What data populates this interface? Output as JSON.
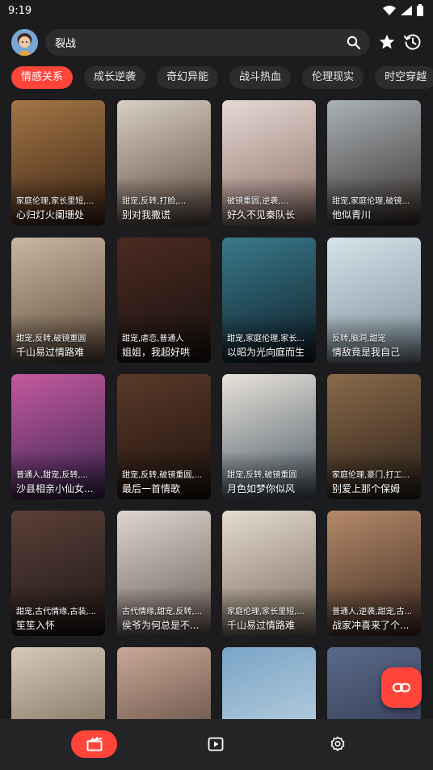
{
  "status": {
    "time": "9:19"
  },
  "search": {
    "value": "裂战"
  },
  "categories": [
    "情感关系",
    "成长逆袭",
    "奇幻异能",
    "战斗热血",
    "伦理现实",
    "时空穿越"
  ],
  "active_category": "情感关系",
  "dramas": [
    {
      "tags": "家庭伦理,家长里短,...",
      "title": "心归灯火阑珊处",
      "colors": [
        "#a37646",
        "#3c2414"
      ]
    },
    {
      "tags": "甜宠,反转,打脸,...",
      "title": "别对我撒谎",
      "colors": [
        "#d9cfc4",
        "#5b4a3f"
      ]
    },
    {
      "tags": "破镜重圆,逆袭,...",
      "title": "好久不见秦队长",
      "colors": [
        "#e6d9d3",
        "#8a6e66"
      ]
    },
    {
      "tags": "甜宠,家庭伦理,破镜...",
      "title": "他似青川",
      "colors": [
        "#aab2b8",
        "#38302b"
      ]
    },
    {
      "tags": "甜宠,反转,破镜重圆",
      "title": "千山易过情路难",
      "colors": [
        "#c9b7a1",
        "#5e4b3b"
      ]
    },
    {
      "tags": "甜宠,虐恋,普通人",
      "title": "姐姐，我超好哄",
      "colors": [
        "#4b2b22",
        "#17100d"
      ]
    },
    {
      "tags": "甜宠,家庭伦理,家长...",
      "title": "以昭为光向庭而生",
      "colors": [
        "#3a7a8c",
        "#0e1e27"
      ]
    },
    {
      "tags": "反转,脑洞,甜宠",
      "title": "情敌竟是我自己",
      "colors": [
        "#d5e3ea",
        "#7d8f99"
      ]
    },
    {
      "tags": "普通人,甜宠,反转,...",
      "title": "沙县相亲小仙女...",
      "colors": [
        "#c45aa0",
        "#3a2450"
      ]
    },
    {
      "tags": "甜宠,反转,破镜重圆,...",
      "title": "最后一首情歌",
      "colors": [
        "#5a3a2a",
        "#1d120c"
      ]
    },
    {
      "tags": "甜宠,反转,破镜重圆",
      "title": "月色如梦你似风",
      "colors": [
        "#e8e2da",
        "#4a5a66"
      ]
    },
    {
      "tags": "家庭伦理,豪门,打工...",
      "title": "别爱上那个保姆",
      "colors": [
        "#8a6a4a",
        "#2a2018"
      ]
    },
    {
      "tags": "甜宠,古代情缘,古装,...",
      "title": "笙笙入怀",
      "colors": [
        "#5a4038",
        "#1e1614"
      ]
    },
    {
      "tags": "古代情缘,甜宠,反转,...",
      "title": "侯爷为何总是不...",
      "colors": [
        "#dcd6ce",
        "#6a5a56"
      ]
    },
    {
      "tags": "家庭伦理,家长里短,...",
      "title": "千山易过情路难",
      "colors": [
        "#e4dbd0",
        "#7a6a5a"
      ]
    },
    {
      "tags": "普通人,逆袭,甜宠,古...",
      "title": "战家冲喜来了个...",
      "colors": [
        "#b58a6a",
        "#3e2a20"
      ]
    },
    {
      "tags": "",
      "title": "",
      "colors": [
        "#d8c8b8",
        "#6a5a4a"
      ]
    },
    {
      "tags": "",
      "title": "",
      "colors": [
        "#caa898",
        "#4a3a30"
      ]
    },
    {
      "tags": "",
      "title": "",
      "colors": [
        "#7aa4c6",
        "#c8dae6"
      ]
    },
    {
      "tags": "",
      "title": "",
      "colors": [
        "#5a6a8a",
        "#2a3048"
      ]
    }
  ],
  "colors": {
    "accent": "#ff453a",
    "background": "#1c1c1e",
    "surface": "#2c2c2e",
    "nav": "#242426"
  }
}
